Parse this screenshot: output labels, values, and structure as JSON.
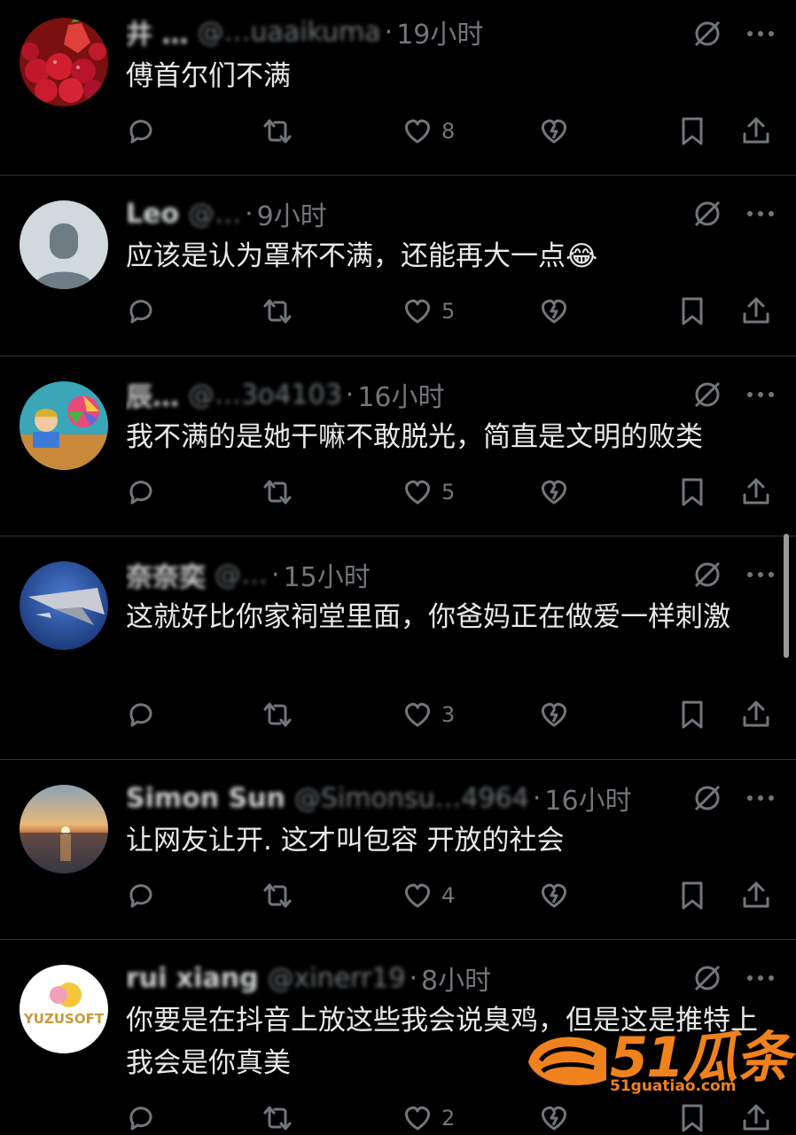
{
  "tweets": [
    {
      "name": "井 …",
      "handle": "@…uaaikuma",
      "time": "19小时",
      "text": "傅首尔们不满",
      "likes": "8",
      "avatar": "strawberries"
    },
    {
      "name": "Leo",
      "handle": "@…",
      "time": "9小时",
      "text": "应该是认为罩杯不满，还能再大一点😂",
      "likes": "5",
      "avatar": "default"
    },
    {
      "name": "辰…",
      "handle": "@…3o4103",
      "time": "16小时",
      "text": "我不满的是她干嘛不敢脱光，简直是文明的败类",
      "likes": "5",
      "avatar": "cartoon"
    },
    {
      "name": "奈奈奕",
      "handle": "@…",
      "time": "15小时",
      "text": "这就好比你家祠堂里面，你爸妈正在做爱一样刺激",
      "likes": "3",
      "avatar": "jet"
    },
    {
      "name": "Simon Sun",
      "handle": "@Simonsu…4964",
      "time": "16小时",
      "text": "让网友让开. 这才叫包容 开放的社会",
      "likes": "4",
      "avatar": "sunset"
    },
    {
      "name": "rui xiang",
      "handle": "@xinerr19",
      "time": "8小时",
      "text": "你要是在抖音上放这些我会说臭鸡，但是这是推特上我会是你真美",
      "likes": "2",
      "avatar": "yuzusoft"
    }
  ],
  "avatar_texts": {
    "yuzusoft": "YUZUSOFT"
  },
  "separator": "·",
  "watermark": {
    "main": "51瓜条",
    "url": "51guatiao.com"
  },
  "icons": [
    "reply-icon",
    "retweet-icon",
    "like-icon",
    "dislike-icon",
    "bookmark-icon",
    "share-icon",
    "grok-icon",
    "more-icon"
  ],
  "colors": {
    "background": "#000000",
    "text": "#e7e9ea",
    "muted": "#71767b",
    "divider": "#2f3336",
    "watermark": "#f0821e"
  }
}
